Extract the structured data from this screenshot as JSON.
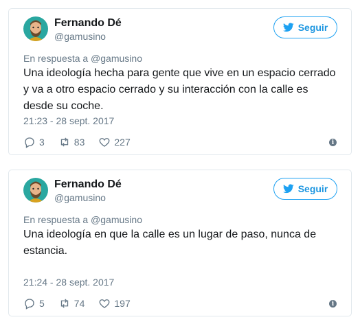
{
  "tweets": [
    {
      "author": {
        "name": "Fernando Dé",
        "handle": "@gamusino"
      },
      "follow_label": "Seguir",
      "reply_to": "En respuesta a @gamusino",
      "text": "Una ideología hecha para gente que vive en un espacio cerrado y va a otro espacio cerrado y su interacción con la calle es desde su coche.",
      "timestamp": "21:23 - 28 sept. 2017",
      "replies": "3",
      "retweets": "83",
      "likes": "227"
    },
    {
      "author": {
        "name": "Fernando Dé",
        "handle": "@gamusino"
      },
      "follow_label": "Seguir",
      "reply_to": "En respuesta a @gamusino",
      "text": "Una ideología en que la calle es un lugar de paso, nunca de estancia.",
      "timestamp": "21:24 - 28 sept. 2017",
      "replies": "5",
      "retweets": "74",
      "likes": "197"
    }
  ],
  "colors": {
    "accent": "#1da1f2",
    "muted": "#657786",
    "border": "#e1e8ed",
    "text": "#14171a"
  },
  "icons": [
    "avatar",
    "twitter-bird-icon",
    "reply-icon",
    "retweet-icon",
    "like-icon",
    "info-icon"
  ]
}
